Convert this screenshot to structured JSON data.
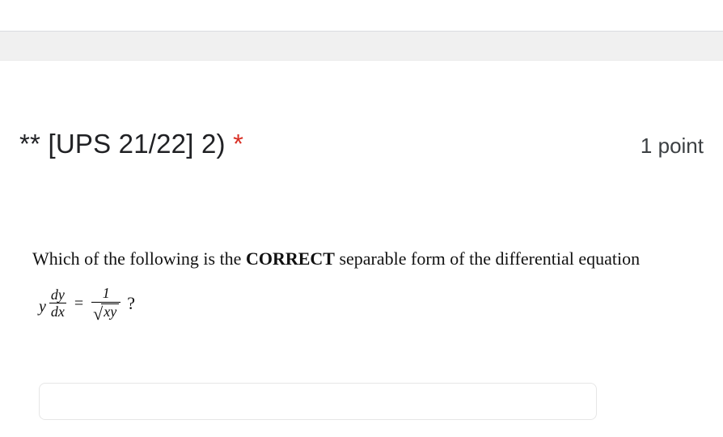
{
  "header": {
    "title": "** [UPS 21/22] 2) ",
    "required_marker": "*",
    "points": "1 point"
  },
  "question": {
    "prefix": "Which of the following is the ",
    "emph": "CORRECT",
    "suffix": " separable form of the differential equation"
  },
  "equation": {
    "y": "y",
    "frac1_num": "dy",
    "frac1_den": "dx",
    "equals": "=",
    "frac2_num": "1",
    "sqrt_sym": "√",
    "radicand": "xy",
    "qmark": "?"
  }
}
